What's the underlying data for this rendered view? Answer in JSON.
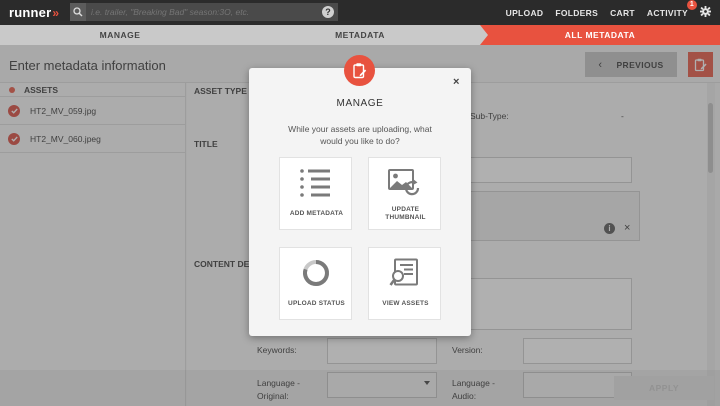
{
  "topbar": {
    "logo_text": "runner",
    "logo_chevrons": "»",
    "search_placeholder": "i.e. trailer, \"Breaking Bad\" season:3O, etc.",
    "help_glyph": "?",
    "nav": [
      {
        "label": "UPLOAD"
      },
      {
        "label": "FOLDERS"
      },
      {
        "label": "CART"
      },
      {
        "label": "ACTIVITY",
        "badge": "1"
      }
    ]
  },
  "steps": [
    {
      "label": "MANAGE",
      "state": "done"
    },
    {
      "label": "METADATA",
      "state": "done"
    },
    {
      "label": "ALL METADATA",
      "state": "active"
    }
  ],
  "header": {
    "title": "Enter metadata information",
    "previous_label": "PREVIOUS"
  },
  "assets": {
    "heading": "ASSETS",
    "items": [
      {
        "name": "HT2_MV_059.jpg"
      },
      {
        "name": "HT2_MV_060.jpeg"
      }
    ]
  },
  "form": {
    "asset_type_heading": "ASSET TYPE",
    "sub_type_label": "Sub-Type:",
    "sub_type_value": "-",
    "title_heading": "TITLE",
    "content_heading": "CONTENT DE",
    "keywords_label": "Keywords:",
    "version_label": "Version:",
    "language_original_label_1": "Language -",
    "language_original_label_2": "Original:",
    "language_audio_label_1": "Language -",
    "language_audio_label_2": "Audio:",
    "info_glyph": "i",
    "remove_glyph": "×"
  },
  "apply_label": "APPLY",
  "modal": {
    "title": "MANAGE",
    "subtitle": "While your assets are uploading, what would you like to do?",
    "close_glyph": "×",
    "options": [
      {
        "label": "ADD METADATA",
        "icon": "list-icon"
      },
      {
        "label_line1": "UPDATE",
        "label_line2": "THUMBNAIL",
        "icon": "thumbnail-refresh-icon"
      },
      {
        "label": "UPLOAD STATUS",
        "icon": "progress-ring-icon"
      },
      {
        "label": "VIEW ASSETS",
        "icon": "search-document-icon"
      }
    ]
  },
  "colors": {
    "accent": "#e8523f",
    "topbar": "#2b2b2b",
    "step_inactive": "#c9c9c9"
  }
}
